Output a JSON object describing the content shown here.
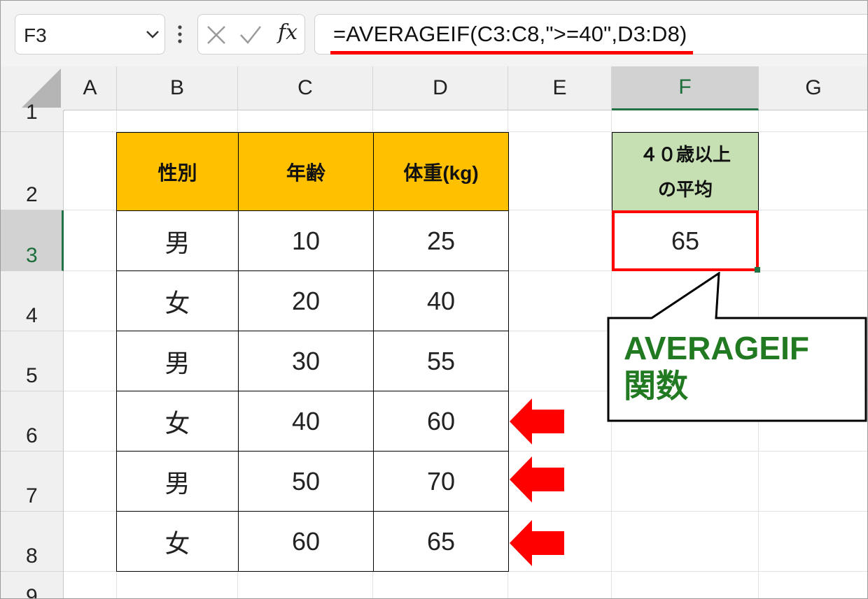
{
  "formula_bar": {
    "name_box": "F3",
    "fx_label": "fx",
    "formula": "=AVERAGEIF(C3:C8,\">=40\",D3:D8)"
  },
  "columns": [
    "A",
    "B",
    "C",
    "D",
    "E",
    "F",
    "G"
  ],
  "rows": [
    "1",
    "2",
    "3",
    "4",
    "5",
    "6",
    "7",
    "8",
    "9"
  ],
  "table": {
    "headers": [
      "性別",
      "年齢",
      "体重(kg)"
    ],
    "rows": [
      [
        "男",
        "10",
        "25"
      ],
      [
        "女",
        "20",
        "40"
      ],
      [
        "男",
        "30",
        "55"
      ],
      [
        "女",
        "40",
        "60"
      ],
      [
        "男",
        "50",
        "70"
      ],
      [
        "女",
        "60",
        "65"
      ]
    ]
  },
  "summary": {
    "header_line1": "４０歳以上",
    "header_line2": "の平均",
    "value": "65"
  },
  "callout": {
    "line1": "AVERAGEIF",
    "line2": "関数"
  },
  "colors": {
    "table_header": "#ffc000",
    "summary_header": "#c6e0b4",
    "highlight": "#ff0000",
    "callout_text": "#217a21",
    "selection": "#217346"
  }
}
